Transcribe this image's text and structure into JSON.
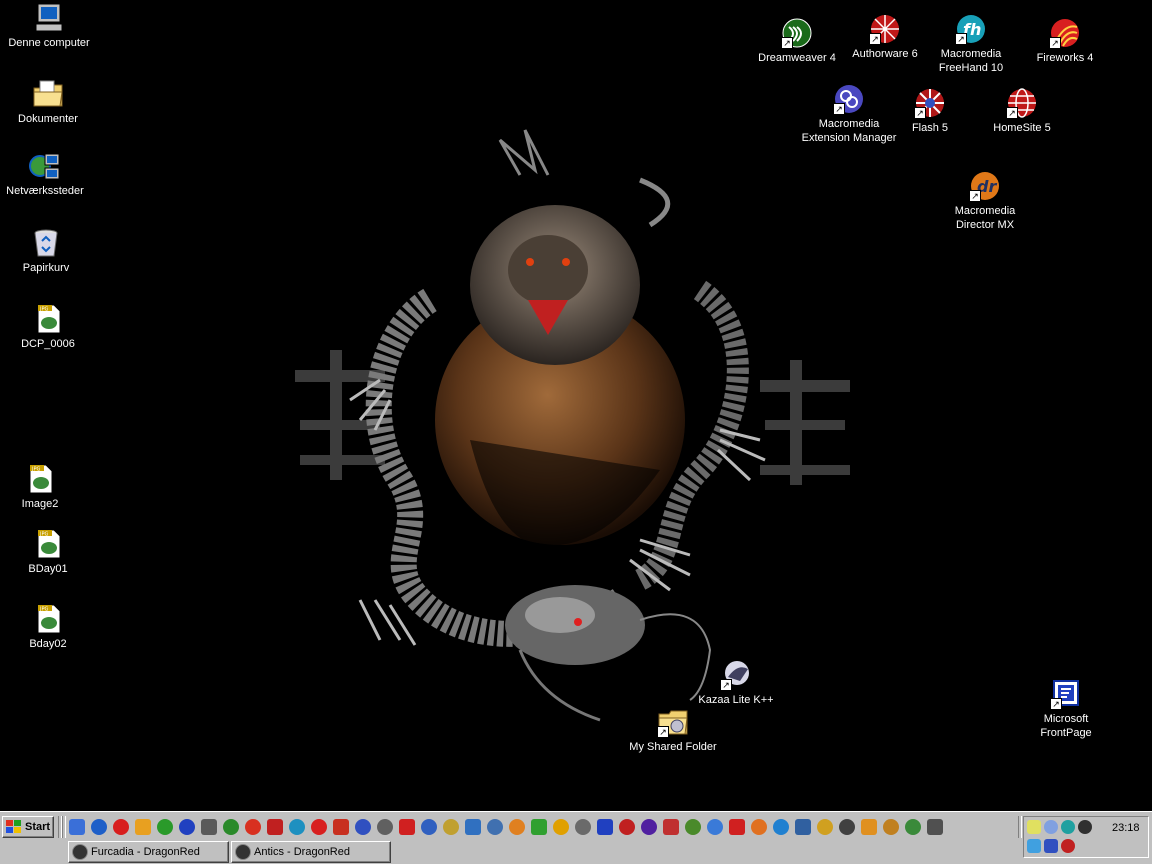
{
  "desktop": {
    "left_icons": [
      {
        "label": "Denne computer",
        "icon": "computer-icon"
      },
      {
        "label": "Dokumenter",
        "icon": "documents-folder-icon"
      },
      {
        "label": "Netværkssteder",
        "icon": "network-places-icon"
      },
      {
        "label": "Papirkurv",
        "icon": "recycle-bin-icon"
      },
      {
        "label": "DCP_0006",
        "icon": "jpg-file-icon"
      },
      {
        "label": "Image2",
        "icon": "jpg-file-icon"
      },
      {
        "label": "BDay01",
        "icon": "jpg-file-icon"
      },
      {
        "label": "Bday02",
        "icon": "jpg-file-icon"
      }
    ],
    "top_icons": [
      {
        "label": "Dreamweaver 4",
        "icon": "dreamweaver-icon"
      },
      {
        "label": "Authorware 6",
        "icon": "authorware-icon"
      },
      {
        "label": "Macromedia\nFreeHand 10",
        "icon": "freehand-icon"
      },
      {
        "label": "Fireworks 4",
        "icon": "fireworks-icon"
      },
      {
        "label": "Macromedia\nExtension Manager",
        "icon": "extension-manager-icon"
      },
      {
        "label": "Flash 5",
        "icon": "flash-icon"
      },
      {
        "label": "HomeSite 5",
        "icon": "homesite-icon"
      },
      {
        "label": "Macromedia\nDirector MX",
        "icon": "director-icon"
      }
    ],
    "other_icons": [
      {
        "label": "Kazaa Lite K++",
        "icon": "kazaa-icon"
      },
      {
        "label": "My Shared Folder",
        "icon": "shared-folder-icon"
      },
      {
        "label": "Microsoft\nFrontPage",
        "icon": "frontpage-icon"
      }
    ],
    "wallpaper": {
      "description_icon": "dragon-tiger-wallpaper"
    },
    "colors": {
      "background": "#000000",
      "label_text": "#ffffff"
    }
  },
  "taskbar": {
    "start_label": "Start",
    "clock": "23:18",
    "tasks": [
      {
        "label": "Furcadia - DragonRed",
        "icon": "furcadia-icon"
      },
      {
        "label": "Antics - DragonRed",
        "icon": "antics-icon"
      }
    ],
    "quick_launch_colors": [
      "#3a6fd8",
      "#1e5fc8",
      "#d81e1e",
      "#e8a020",
      "#2a9a2a",
      "#2040c0",
      "#5a5a5a",
      "#2a8a2a",
      "#d83020",
      "#c02020",
      "#1e90c0",
      "#d82020",
      "#c83020",
      "#3050c0",
      "#606060",
      "#d02020",
      "#3060c0",
      "#c0a030",
      "#3070c0",
      "#4070b0",
      "#e08020",
      "#30a030",
      "#e0a000",
      "#6a6a6a",
      "#2040c0",
      "#c02020",
      "#5020a0",
      "#c03030",
      "#4a8a2a",
      "#3a7ad8",
      "#d02020",
      "#e07020",
      "#2080d0",
      "#3060a0",
      "#d0a020",
      "#404040",
      "#e09020",
      "#c08020",
      "#3a8a3a",
      "#505050"
    ],
    "tray_icons": [
      "volume-icon",
      "network-icon",
      "antivirus-icon",
      "messenger-icon",
      "tray-app-icon",
      "tray-app2-icon",
      "tray-app3-icon"
    ],
    "colors": {
      "face": "#c0c0c0"
    }
  }
}
